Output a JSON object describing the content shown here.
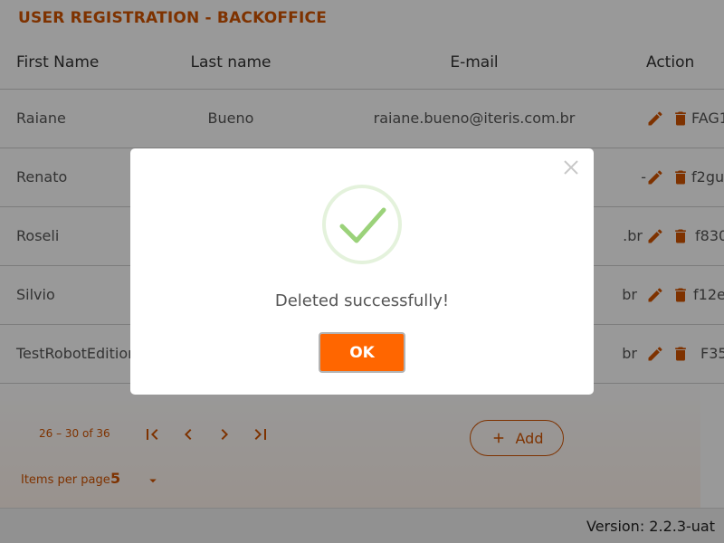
{
  "page": {
    "title": "USER REGISTRATION - BACKOFFICE"
  },
  "table": {
    "headers": [
      "First Name",
      "Last name",
      "E-mail",
      "Action"
    ],
    "rows": [
      {
        "first": "Raiane",
        "last": "Bueno",
        "email": "raiane.bueno@iteris.com.br",
        "id": "FAG1"
      },
      {
        "first": "Renato",
        "last": "",
        "email": "",
        "id": "f2gu"
      },
      {
        "first": "Roseli",
        "last": "",
        "email": "",
        "id": "f830"
      },
      {
        "first": "Silvio",
        "last": "",
        "email": "",
        "id": "f12e"
      },
      {
        "first": "TestRobotEdition",
        "last": "",
        "email": "",
        "id": "F35"
      }
    ],
    "partial_email_tails": [
      "-",
      ".br",
      "br",
      "br"
    ]
  },
  "pagination": {
    "range": "26 – 30 of 36",
    "items_per_page_label": "Items per page",
    "items_per_page_value": "5",
    "add_label": "Add",
    "icons": [
      "first-page-icon",
      "chevron-left-icon",
      "chevron-right-icon",
      "last-page-icon",
      "dropdown-arrow-icon",
      "plus-icon"
    ]
  },
  "footer": {
    "version": "Version: 2.2.3-uat"
  },
  "modal": {
    "message": "Deleted successfully!",
    "ok_label": "OK",
    "icons": [
      "close-icon",
      "success-check-icon"
    ]
  },
  "colors": {
    "accent": "#d35400",
    "ok_button": "#ff6600",
    "check": "#9bd27a"
  }
}
